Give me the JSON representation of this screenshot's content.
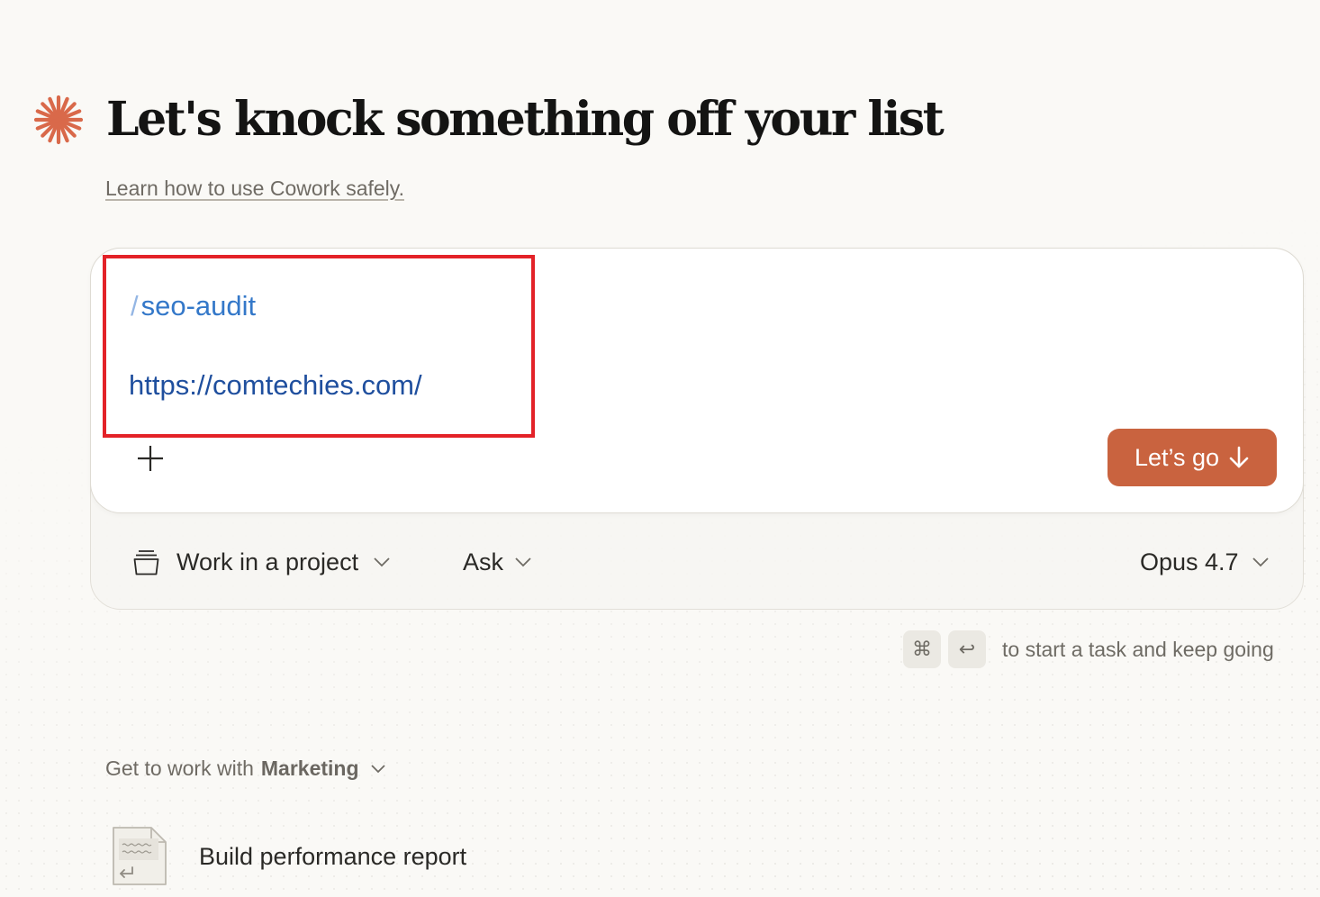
{
  "header": {
    "title": "Let's knock something off your list",
    "learn_link": "Learn how to use Cowork safely.",
    "brand_color": "#d9694a"
  },
  "composer": {
    "command_slash": "/",
    "command": "seo-audit",
    "url": "https://comtechies.com/",
    "attach_icon": "plus-icon",
    "submit_label": "Let’s go",
    "submit_color": "#c9633f",
    "highlight_color": "#e32228"
  },
  "options": {
    "project_label": "Work in a project",
    "mode_label": "Ask",
    "model_label": "Opus 4.7"
  },
  "shortcut": {
    "keys": [
      "⌘",
      "↩"
    ],
    "hint": "to start a task and keep going"
  },
  "suggestions": {
    "prefix": "Get to work with",
    "department": "Marketing",
    "items": [
      {
        "label": "Build performance report",
        "icon": "document-icon"
      }
    ]
  }
}
